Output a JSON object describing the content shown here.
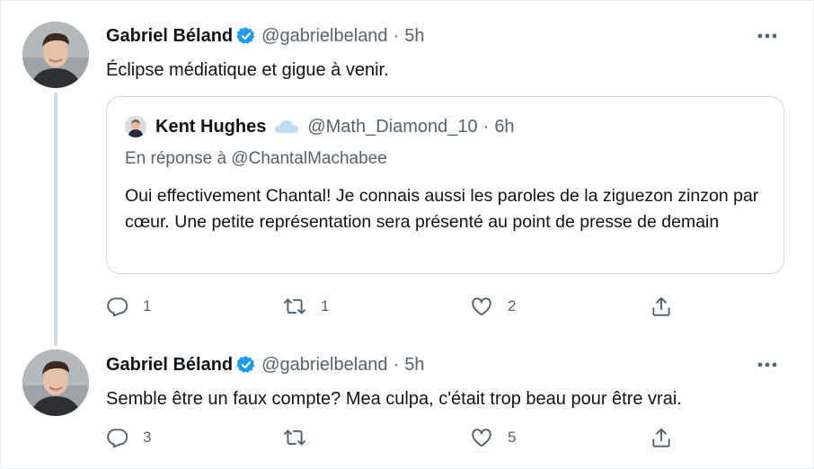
{
  "thread": {
    "tweets": [
      {
        "author_name": "Gabriel Béland",
        "handle": "@gabrielbeland",
        "separator": "·",
        "time": "5h",
        "text": "Éclipse médiatique et gigue à venir.",
        "quote": {
          "author_name": "Kent Hughes",
          "handle": "@Math_Diamond_10",
          "separator": "·",
          "time": "6h",
          "reply_context": "En réponse à @ChantalMachabee",
          "text": "Oui effectivement Chantal! Je connais aussi les paroles de la ziguezon zinzon par cœur. Une petite représentation sera présenté au point de presse de demain"
        },
        "counts": {
          "reply": "1",
          "retweet": "1",
          "like": "2"
        }
      },
      {
        "author_name": "Gabriel Béland",
        "handle": "@gabrielbeland",
        "separator": "·",
        "time": "5h",
        "text": "Semble être un faux compte? Mea culpa, c'était trop beau pour être vrai.",
        "counts": {
          "reply": "3",
          "retweet": "",
          "like": "5"
        }
      }
    ]
  },
  "icons": {
    "verified": "verified-badge-icon",
    "more": "more-dots-icon",
    "reply": "reply-icon",
    "retweet": "retweet-icon",
    "like": "heart-icon",
    "share": "share-icon",
    "cloud": "cloud-icon"
  },
  "colors": {
    "verified_blue": "#1d9bf0",
    "text_primary": "#0f1419",
    "text_secondary": "#536471",
    "border": "#cfd9de",
    "cloud": "#bfdcf7"
  }
}
